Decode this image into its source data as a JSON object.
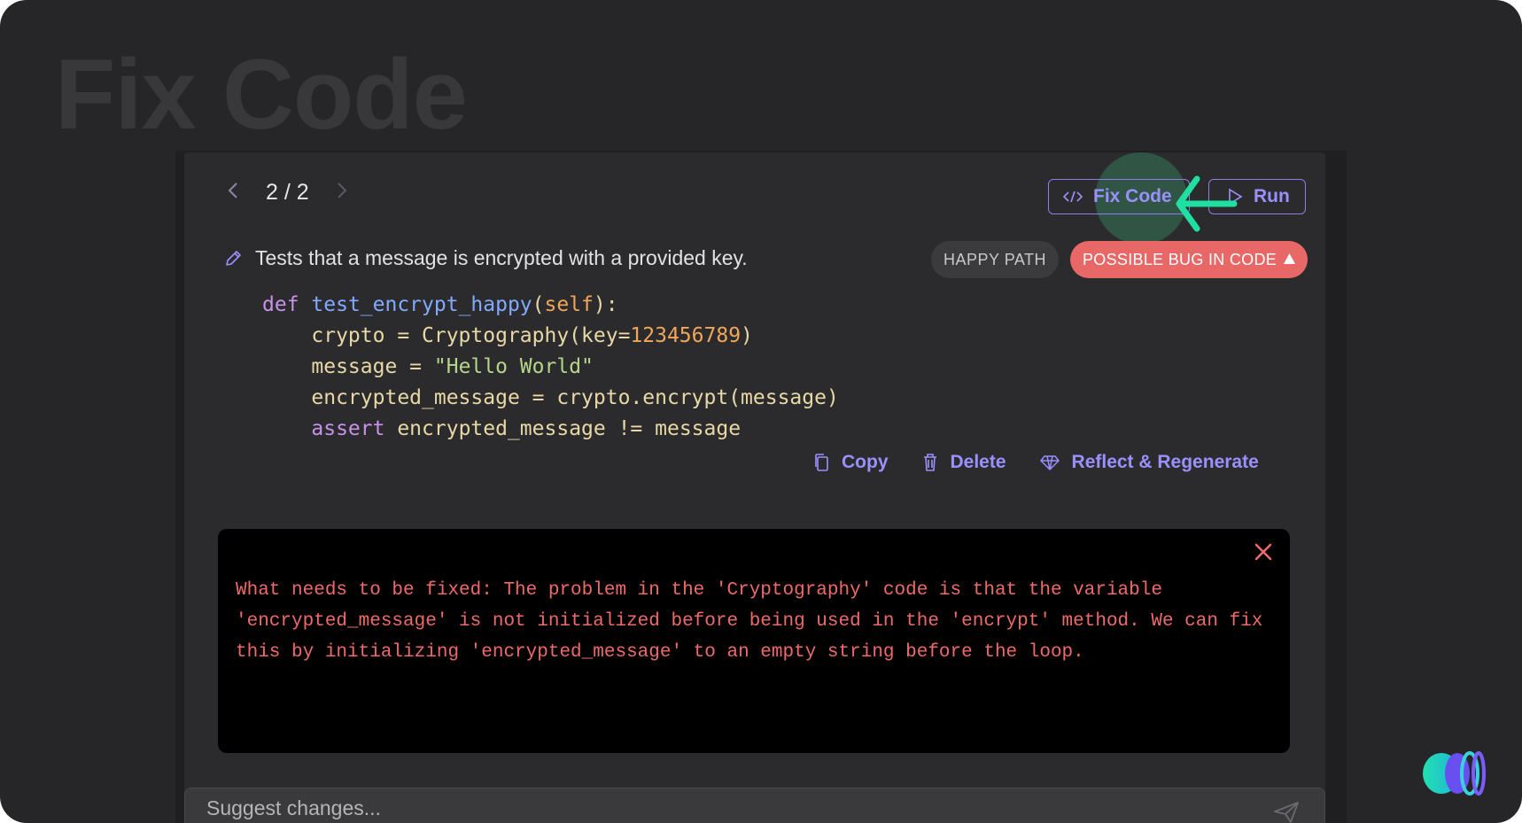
{
  "background_title": "Fix Code",
  "pager": {
    "prev_icon": "chevron-left-icon",
    "count": "2 / 2",
    "next_icon": "chevron-right-icon"
  },
  "toolbar": {
    "fix_code_label": "Fix Code",
    "run_label": "Run"
  },
  "test": {
    "description": "Tests that a message is encrypted with a provided key.",
    "tags": {
      "happy_path": "HAPPY PATH",
      "bug": "POSSIBLE BUG IN CODE",
      "bug_icon": "warning-triangle-icon"
    },
    "code": {
      "line1": {
        "kw": "def",
        "fn": "test_encrypt_happy",
        "open": "(",
        "self": "self",
        "close": "):"
      },
      "line2": {
        "lhs": "    crypto = Cryptography(key=",
        "num": "123456789",
        "rhs": ")"
      },
      "line3": {
        "lhs": "    message = ",
        "str": "\"Hello World\""
      },
      "line4": {
        "text": "    encrypted_message = crypto.encrypt(message)"
      },
      "line5": {
        "indent": "    ",
        "kw": "assert",
        "rest": " encrypted_message != message"
      }
    }
  },
  "actions": {
    "copy": "Copy",
    "delete": "Delete",
    "reflect": "Reflect & Regenerate"
  },
  "error": {
    "text": "What needs to be fixed: The problem in the 'Cryptography' code is that the variable 'encrypted_message' is not initialized before being used in the 'encrypt' method. We can fix this by initializing 'encrypted_message' to an empty string before the loop."
  },
  "suggest": {
    "placeholder": "Suggest changes..."
  },
  "colors": {
    "accent": "#9a90ff",
    "bug_badge": "#e86868",
    "error_text": "#ee6a6a",
    "pointer": "#1fe0a0"
  }
}
